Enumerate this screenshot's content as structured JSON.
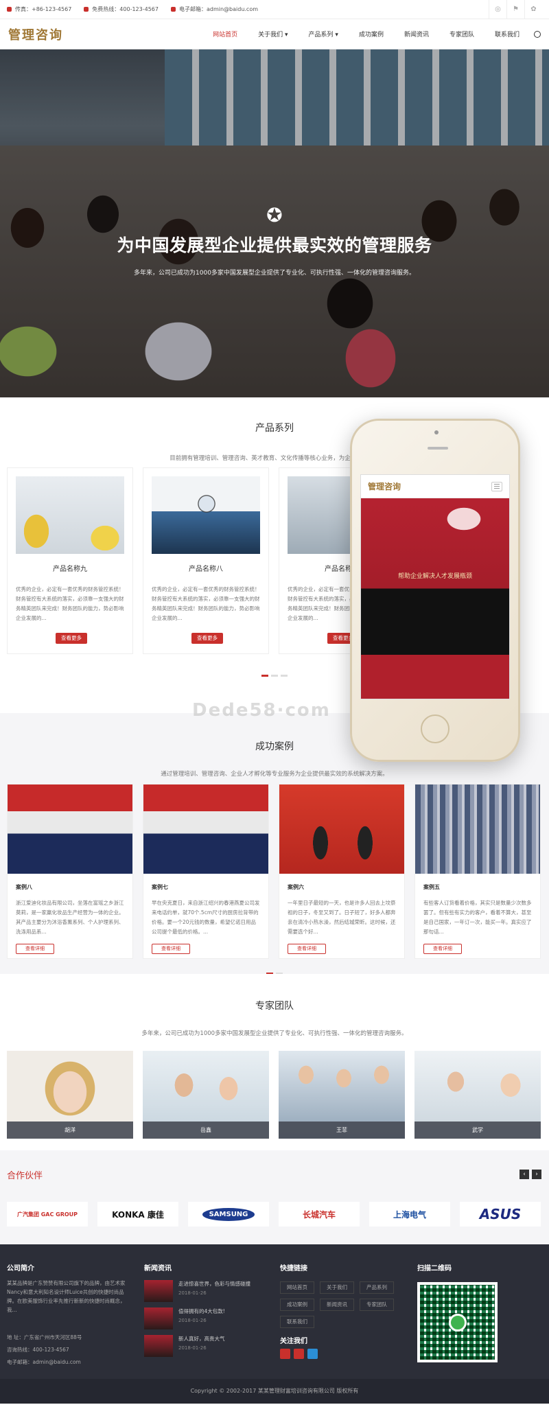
{
  "topbar": {
    "fax": "传真：+86-123-4567",
    "hotline": "免费热线：400-123-4567",
    "email": "电子邮箱：admin@baidu.com"
  },
  "nav": {
    "logo": "管理咨询",
    "items": [
      "网站首页",
      "关于我们 ▾",
      "产品系列 ▾",
      "成功案例",
      "新闻资讯",
      "专家团队",
      "联系我们"
    ]
  },
  "banner": {
    "title": "为中国发展型企业提供最实效的管理服务",
    "subtitle": "多年来，公司已成功为1000多家中国发展型企业提供了专业化、可执行性强、一体化的管理咨询服务。"
  },
  "products": {
    "title": "产品系列",
    "subtitle": "目前拥有管理培训、管理咨询、英才教育、文化传播等核心业务，为企业提供最...",
    "desc": "优秀的企业，必定有一套优秀的财务管控系统！财务管控有大系统的落实，必须靠一支强大的财务精英团队来完成！财务团队的能力，势必影响企业发展的...",
    "button": "查看更多",
    "items": [
      {
        "name": "产品名称九",
        "image": "golden-egg-city"
      },
      {
        "name": "产品名称八",
        "image": "magnifier-diamond"
      },
      {
        "name": "产品名称七",
        "image": "service-sign"
      }
    ]
  },
  "phone": {
    "logo": "管理咨询",
    "caption": "帮助企业解决人才发展瓶颈",
    "menu_icon": "hamburger-icon"
  },
  "watermark": "Dede58·com",
  "cases": {
    "title": "成功案例",
    "subtitle": "通过管理培训、管理咨询、企业人才孵化等专业服务为企业提供最实效的系统解决方案。",
    "button": "查看详细",
    "items": [
      {
        "name": "案例八",
        "desc": "浙江爱迪化妆品有限公司，坐落在富瑶之乡浙江莫莉，是一家羸化妆品生产经营为一体的企业。其产品主要分为沐浴香薰系列、个人护理系列、洗涤用品系..."
      },
      {
        "name": "案例七",
        "desc": "早在央克夏日，来自浙江绍兴的春港燕夏公司发来电话约单，就70个.5cm尺寸的厨房拉背带的价格。要一个20元钱的数量，希望亿诺日用品公司提个最低的价格。..."
      },
      {
        "name": "案例六",
        "desc": "一年里日子最短的一天，也是许多人回去上坟祭祖的日子，冬至又到了。日子短了，好多人都奔亲在清冷小热水澡，然后结城荣昕。这时候，还需要选个好..."
      },
      {
        "name": "案例五",
        "desc": "有些客人订货看着价格，其实只是数量少次数多罢了。但有些有实力的客户，看着不算大，甚至是自己国家，一年订一次，能买一年。真实应了那句话..."
      }
    ]
  },
  "team": {
    "title": "专家团队",
    "subtitle": "多年来，公司已成功为1000多家中国发展型企业提供了专业化、可执行性强、一体化的管理咨询服务。",
    "members": [
      "胡洋",
      "岳鑫",
      "王菲",
      "武学"
    ]
  },
  "partners": {
    "title": "合作伙伴",
    "logos": [
      "广汽集团 GAC GROUP",
      "KONKA 康佳",
      "SAMSUNG",
      "长城汽车",
      "上海电气",
      "ASUS"
    ]
  },
  "footer": {
    "about_title": "公司简介",
    "about_text": "某某品牌是广东赞赞有限公司旗下的品牌，由艺术家Nancy和意大利知名设计师Luice共创的快捷时尚品牌。在欧美服饰行业率先推行新新的快捷时尚概念，我...",
    "address": "地 址：广东省广州市天河区88号",
    "phone": "咨询热线：400-123-4567",
    "email": "电子邮箱：admin@baidu.com",
    "news_title": "新闻资讯",
    "news": [
      {
        "title": "走进惊喜世界，色彩与情感碰撞",
        "date": "2018-01-26"
      },
      {
        "title": "值得拥有的4大包款!",
        "date": "2018-01-26"
      },
      {
        "title": "新人真好，高贵大气",
        "date": "2018-01-26"
      }
    ],
    "links_title": "快捷链接",
    "links": [
      "网站首页",
      "关于我们",
      "产品系列",
      "成功案例",
      "新闻资讯",
      "专家团队",
      "联系我们"
    ],
    "follow_title": "关注我们",
    "qr_title": "扫描二维码",
    "copyright": "Copyright © 2002-2017 某某管理财富培训咨询有限公司 版权所有"
  }
}
